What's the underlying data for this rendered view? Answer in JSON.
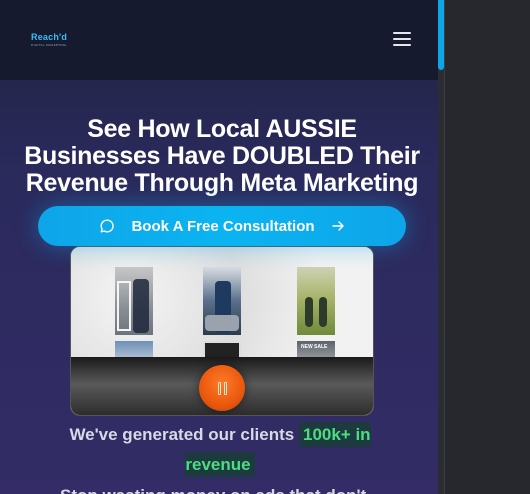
{
  "header": {
    "logo_text": "Reach'd",
    "logo_subtext": "DIGITAL MARKETING",
    "menu_icon": "hamburger-icon"
  },
  "hero": {
    "title": "See How Local AUSSIE Businesses Have DOUBLED Their Revenue Through Meta Marketing",
    "cta_label": "Book A Free Consultation",
    "cta_icon_left": "chat-bubble-icon",
    "cta_icon_right": "arrow-right-icon"
  },
  "video": {
    "thumbnail_tag": "NEW SALE",
    "control_icon": "pause-icon"
  },
  "revenue": {
    "prefix": "We've generated our clients",
    "highlight": "100k+ in revenue"
  },
  "next_line": "Stop wasting money on ads that don't",
  "colors": {
    "accent": "#0ea5e9",
    "highlight_text": "#4ade80",
    "pause_button": "#ea580c",
    "header_bg": "#161a2f"
  }
}
